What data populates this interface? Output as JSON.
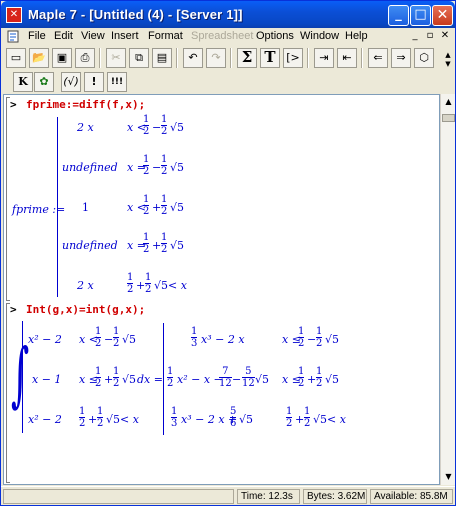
{
  "window": {
    "title": "Maple 7 - [Untitled (4) - [Server 1]]",
    "accent": "#0a4fd6",
    "close_color": "#c63a1c"
  },
  "menu": {
    "items": [
      "File",
      "Edit",
      "View",
      "Insert",
      "Format",
      "Spreadsheet",
      "Options",
      "Window",
      "Help"
    ],
    "disabled": [
      "Spreadsheet"
    ]
  },
  "toolbar": {
    "sigma": "Σ",
    "text": "T",
    "exec": "[>",
    "context_k": "K",
    "italic_paren": "(√)",
    "bang": "!",
    "triple_bang": "!!!"
  },
  "worksheet": {
    "prompt": ">",
    "cmd1": "fprime:=diff(f,x);",
    "lhs1": "fprime :=",
    "rows1": [
      {
        "expr": "2 x",
        "cond_pre": "x <",
        "cond_sign": "−",
        "cond_post": ""
      },
      {
        "expr": "undefined",
        "cond_pre": "x =",
        "cond_sign": "−",
        "cond_post": ""
      },
      {
        "expr": "1",
        "cond_pre": "x <",
        "cond_sign": "+",
        "cond_post": ""
      },
      {
        "expr": "undefined",
        "cond_pre": "x =",
        "cond_sign": "+",
        "cond_post": ""
      },
      {
        "expr": "2 x",
        "cond_pre": "",
        "cond_sign": "+",
        "cond_post": "< x"
      }
    ],
    "cmd2": "Int(g,x)=int(g,x);",
    "rows2_left": [
      {
        "expr": "x² − 2",
        "cond_pre": "x <",
        "cond_sign": "−",
        "cond_post": ""
      },
      {
        "expr": "x − 1",
        "cond_pre": "x ≤",
        "cond_sign": "+",
        "cond_post": "dx ="
      },
      {
        "expr": "x² − 2",
        "cond_pre": "",
        "cond_sign": "+",
        "cond_post": "< x"
      }
    ],
    "rows2_right": [
      {
        "expr": "x³ − 2 x",
        "cond_pre": "x ≤",
        "cond_sign": "−"
      },
      {
        "expr": "x² − x −",
        "cond_pre": "x ≤",
        "cond_sign": "+"
      },
      {
        "expr": "x³ − 2 x +",
        "cond_pre": "",
        "cond_sign": "+"
      }
    ],
    "sqrt5": "√5"
  },
  "status": {
    "time": "Time: 12.3s",
    "bytes": "Bytes: 3.62M",
    "available": "Available: 85.8M"
  }
}
